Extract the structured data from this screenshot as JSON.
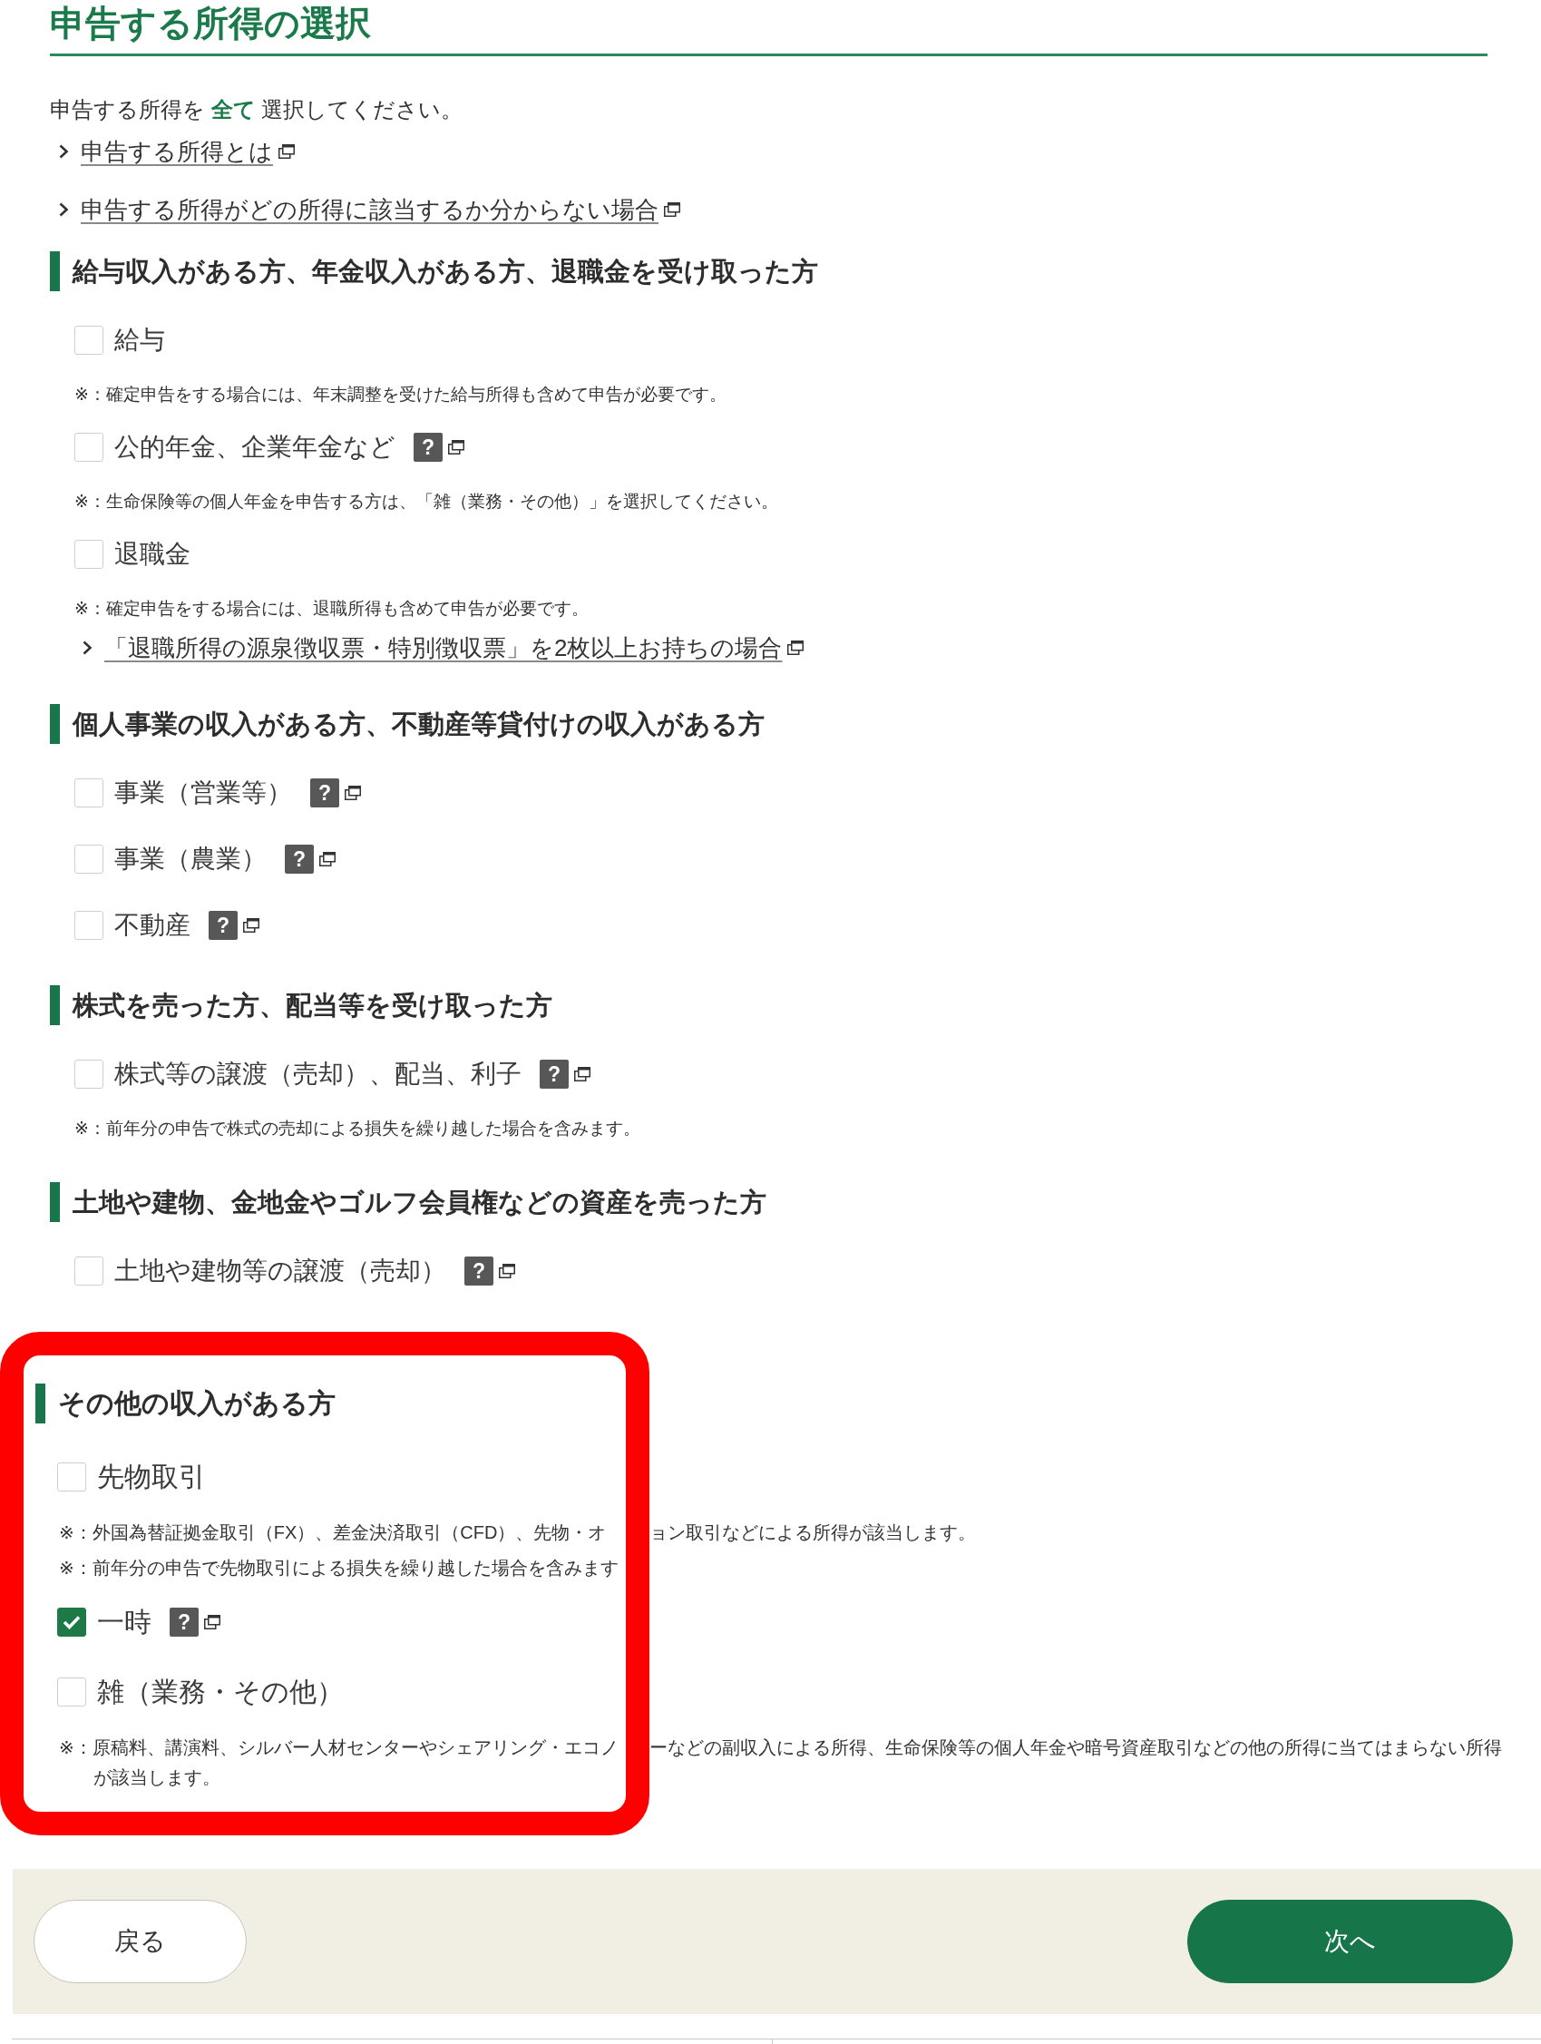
{
  "title": "申告する所得の選択",
  "intro": "申告する所得を **全て** 選択してください。",
  "links": [
    "申告する所得とは",
    "申告する所得がどの所得に該当するか分からない場合"
  ],
  "sections": [
    {
      "heading": "給与収入がある方、年金収入がある方、退職金を受け取った方",
      "highlighted": false,
      "items": [
        {
          "label": "給与",
          "checked": false,
          "notes": [
            {
              "text": "※：確定申告をする場合には、年末調整を受けた給与所得も含めて申告が必要です。"
            }
          ]
        },
        {
          "label": "公的年金、企業年金など",
          "checked": false,
          "help": "?",
          "notes": [
            {
              "text": "※：生命保険等の個人年金を申告する方は、「雑（業務・その他）」を選択してください。"
            }
          ]
        },
        {
          "label": "退職金",
          "checked": false,
          "notes": [
            {
              "text": "※：確定申告をする場合には、退職所得も含めて申告が必要です。"
            }
          ],
          "links": [
            "「退職所得の源泉徴収票・特別徴収票」を2枚以上お持ちの場合"
          ]
        }
      ]
    },
    {
      "heading": "個人事業の収入がある方、不動産等貸付けの収入がある方",
      "highlighted": false,
      "items": [
        {
          "label": "事業（営業等）",
          "checked": false,
          "help": "?"
        },
        {
          "label": "事業（農業）",
          "checked": false,
          "help": "?"
        },
        {
          "label": "不動産",
          "checked": false,
          "help": "?"
        }
      ]
    },
    {
      "heading": "株式を売った方、配当等を受け取った方",
      "highlighted": false,
      "items": [
        {
          "label": "株式等の譲渡（売却）、配当、利子",
          "checked": false,
          "help": "?",
          "notes": [
            {
              "text": "※：前年分の申告で株式の売却による損失を繰り越した場合を含みます。"
            }
          ]
        }
      ]
    },
    {
      "heading": "土地や建物、金地金やゴルフ会員権などの資産を売った方",
      "highlighted": false,
      "items": [
        {
          "label": "土地や建物等の譲渡（売却）",
          "checked": false,
          "help": "?"
        }
      ]
    },
    {
      "heading": "その他の収入がある方",
      "highlighted": true,
      "items": [
        {
          "label": "先物取引",
          "checked": false,
          "notes": [
            {
              "lines": [
                {
                  "inside_frame": "※：外国為替証拠金取引（FX）、差金決済取引（CFD）、先物・オ",
                  "outside_frame": "ョン取引などによる所得が該当します。"
                }
              ]
            },
            {
              "lines": [
                {
                  "inside_frame": "※：前年分の申告で先物取引による損失を繰り越した場合を含みます"
                }
              ]
            }
          ]
        },
        {
          "label": "一時",
          "checked": true,
          "help": "?"
        },
        {
          "label": "雑（業務・その他）",
          "checked": false,
          "notes": [
            {
              "lines": [
                {
                  "inside_frame": "※：原稿料、講演料、シルバー人材センターやシェアリング・エコノ",
                  "outside_frame": "ーなどの副収入による所得、生命保険等の個人年金や暗号資産取引などの他の所得に当てはまらない所得"
                },
                {
                  "inside_frame": "が該当します。"
                }
              ]
            }
          ]
        }
      ]
    }
  ],
  "footer": {
    "back": "戻る",
    "next": "次へ"
  }
}
